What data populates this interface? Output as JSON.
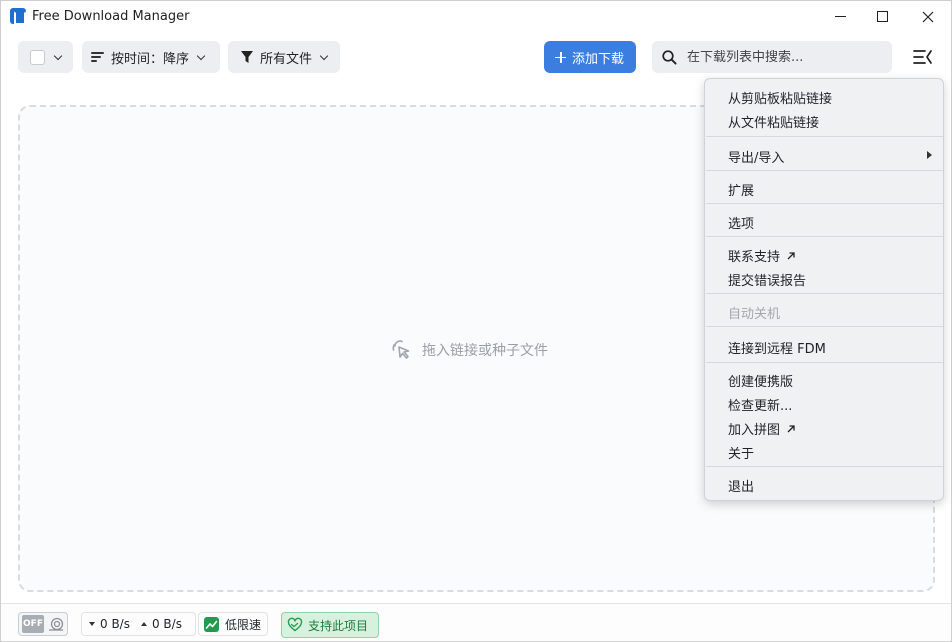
{
  "window": {
    "title": "Free Download Manager"
  },
  "toolbar": {
    "sort_label": "按时间：降序",
    "filter_label": "所有文件",
    "add_label": "添加下载",
    "search_placeholder": "在下载列表中搜索..."
  },
  "dropzone": {
    "hint": "拖入链接或种子文件"
  },
  "menu": {
    "items": [
      {
        "label": "从剪贴板粘贴链接",
        "disabled": false
      },
      {
        "label": "从文件粘贴链接",
        "disabled": false
      },
      {
        "label": "导出/导入",
        "disabled": false,
        "submenu": true
      },
      {
        "label": "扩展",
        "disabled": false
      },
      {
        "label": "选项",
        "disabled": false
      },
      {
        "label": "联系支持",
        "disabled": false,
        "external": true
      },
      {
        "label": "提交错误报告",
        "disabled": false
      },
      {
        "label": "自动关机",
        "disabled": true
      },
      {
        "label": "连接到远程 FDM",
        "disabled": false
      },
      {
        "label": "创建便携版",
        "disabled": false
      },
      {
        "label": "检查更新...",
        "disabled": false
      },
      {
        "label": "加入拼图",
        "disabled": false,
        "external": true
      },
      {
        "label": "关于",
        "disabled": false
      },
      {
        "label": "退出",
        "disabled": false
      }
    ]
  },
  "statusbar": {
    "turbo_label": "OFF",
    "download_speed": "0 B/s",
    "upload_speed": "0 B/s",
    "low_speed_label": "低限速",
    "support_label": "支持此项目"
  },
  "colors": {
    "accent": "#3b7ee0",
    "low_speed_green": "#24994f",
    "support_bg": "#d7f1df",
    "support_text": "#1e7a3c"
  }
}
